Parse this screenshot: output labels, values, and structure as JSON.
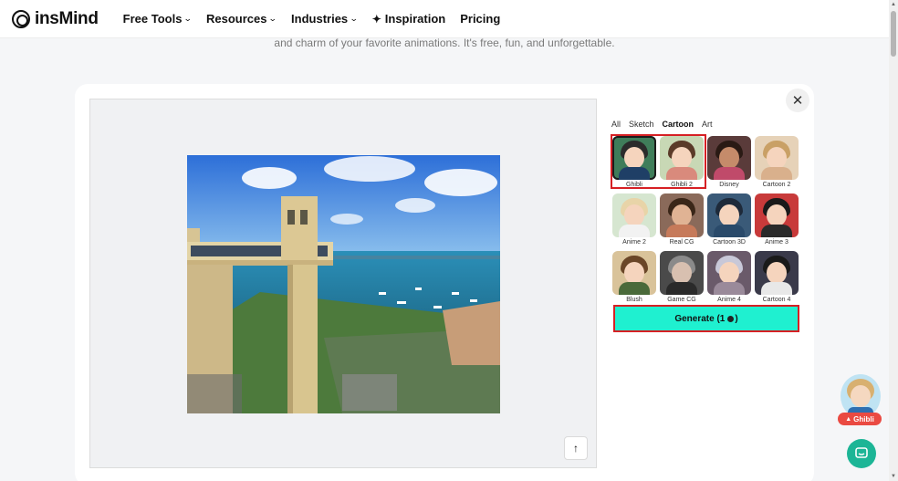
{
  "header": {
    "logo_text": "insMind",
    "nav": [
      {
        "label": "Free Tools",
        "has_dropdown": true
      },
      {
        "label": "Resources",
        "has_dropdown": true
      },
      {
        "label": "Industries",
        "has_dropdown": true
      },
      {
        "label": "Inspiration",
        "icon": "sparkle-icon"
      },
      {
        "label": "Pricing"
      }
    ]
  },
  "page": {
    "subtitle": "and charm of your favorite animations. It's free, fun, and unforgettable."
  },
  "modal": {
    "tabs": [
      {
        "label": "All"
      },
      {
        "label": "Sketch"
      },
      {
        "label": "Cartoon",
        "active": true
      },
      {
        "label": "Art"
      }
    ],
    "styles": [
      {
        "label": "Ghibli",
        "selected": true
      },
      {
        "label": "Ghibli 2"
      },
      {
        "label": "Disney"
      },
      {
        "label": "Cartoon 2"
      },
      {
        "label": "Anime 2"
      },
      {
        "label": "Real CG"
      },
      {
        "label": "Cartoon 3D"
      },
      {
        "label": "Anime 3"
      },
      {
        "label": "Blush"
      },
      {
        "label": "Game CG"
      },
      {
        "label": "Anime 4"
      },
      {
        "label": "Cartoon 4"
      }
    ],
    "generate_label": "Generate (1",
    "generate_suffix": ")"
  },
  "floating": {
    "badge_label": "Ghibli"
  },
  "colors": {
    "accent": "#1ff0d0",
    "highlight": "#d62024",
    "chat": "#1cb596",
    "badge": "#ea4a42"
  }
}
